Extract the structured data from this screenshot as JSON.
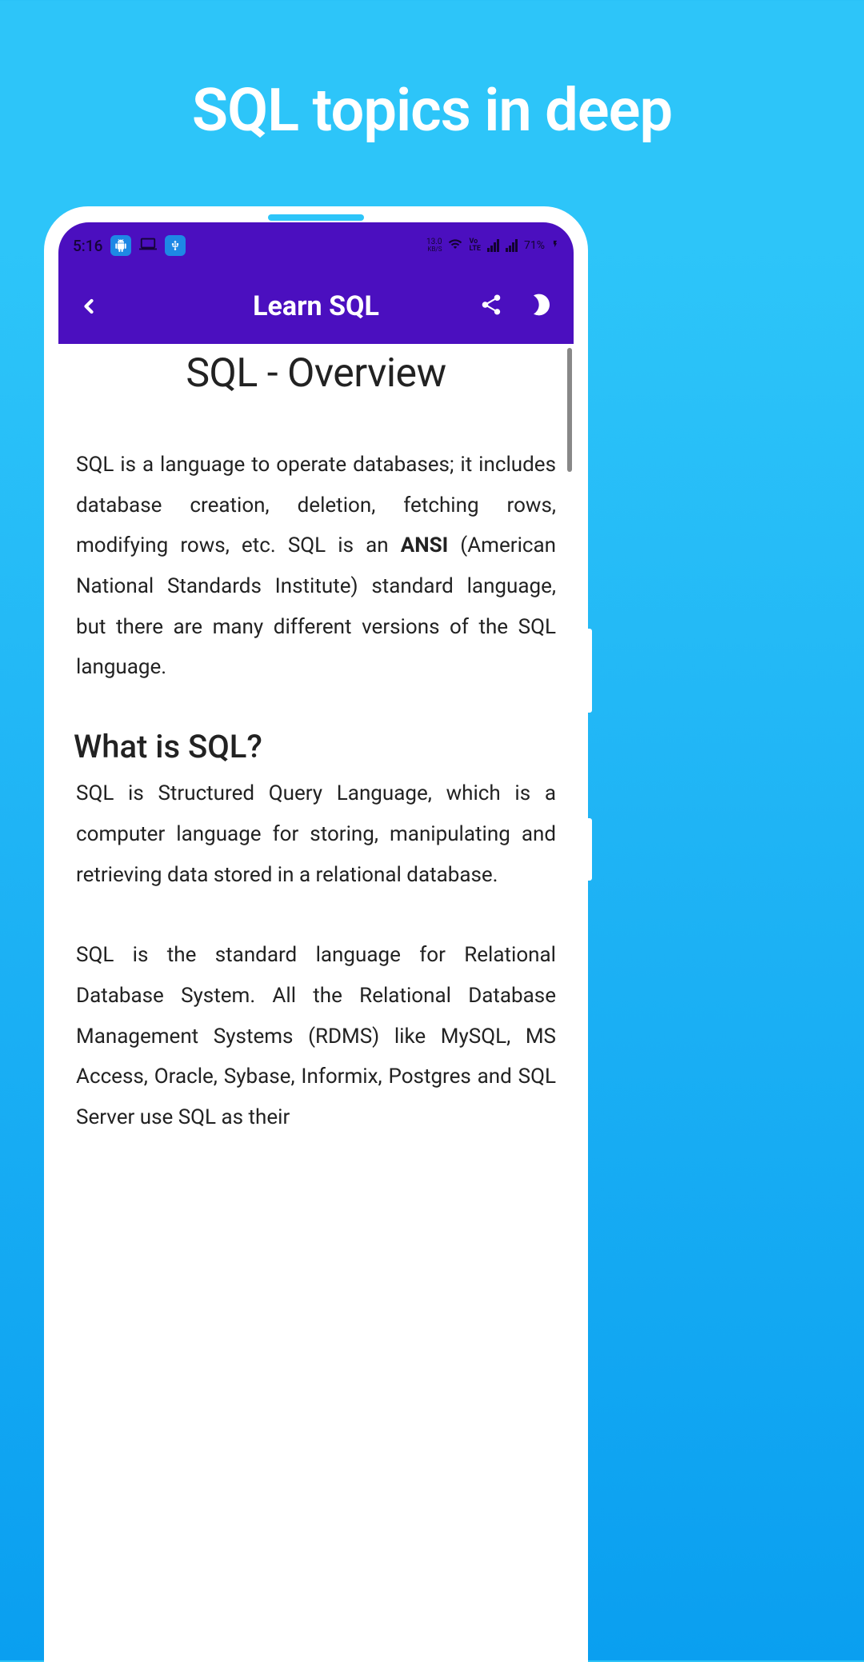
{
  "promo": {
    "title": "SQL topics in deep"
  },
  "status": {
    "time": "5:16",
    "kbps_value": "13.0",
    "kbps_label": "KB/S",
    "volte": "Vo\nLTE",
    "battery": "71%"
  },
  "header": {
    "title": "Learn SQL"
  },
  "content": {
    "heading": "SQL - Overview",
    "paragraph1_part1": "SQL is a language to operate databases; it includes database creation, deletion, fetching rows, modifying rows, etc. SQL is an ",
    "paragraph1_strong": "ANSI",
    "paragraph1_part2": " (American National Standards Institute) standard language, but there are many different versions of the SQL language.",
    "section_heading": "What is SQL?",
    "paragraph2": "SQL is Structured Query Language, which is a computer language for storing, manipulating and retrieving data stored in a relational database.",
    "paragraph3": "SQL is the standard language for Relational Database System. All the Relational Database Management Systems (RDMS) like MySQL, MS Access, Oracle, Sybase, Informix, Postgres and SQL Server use SQL as their"
  }
}
